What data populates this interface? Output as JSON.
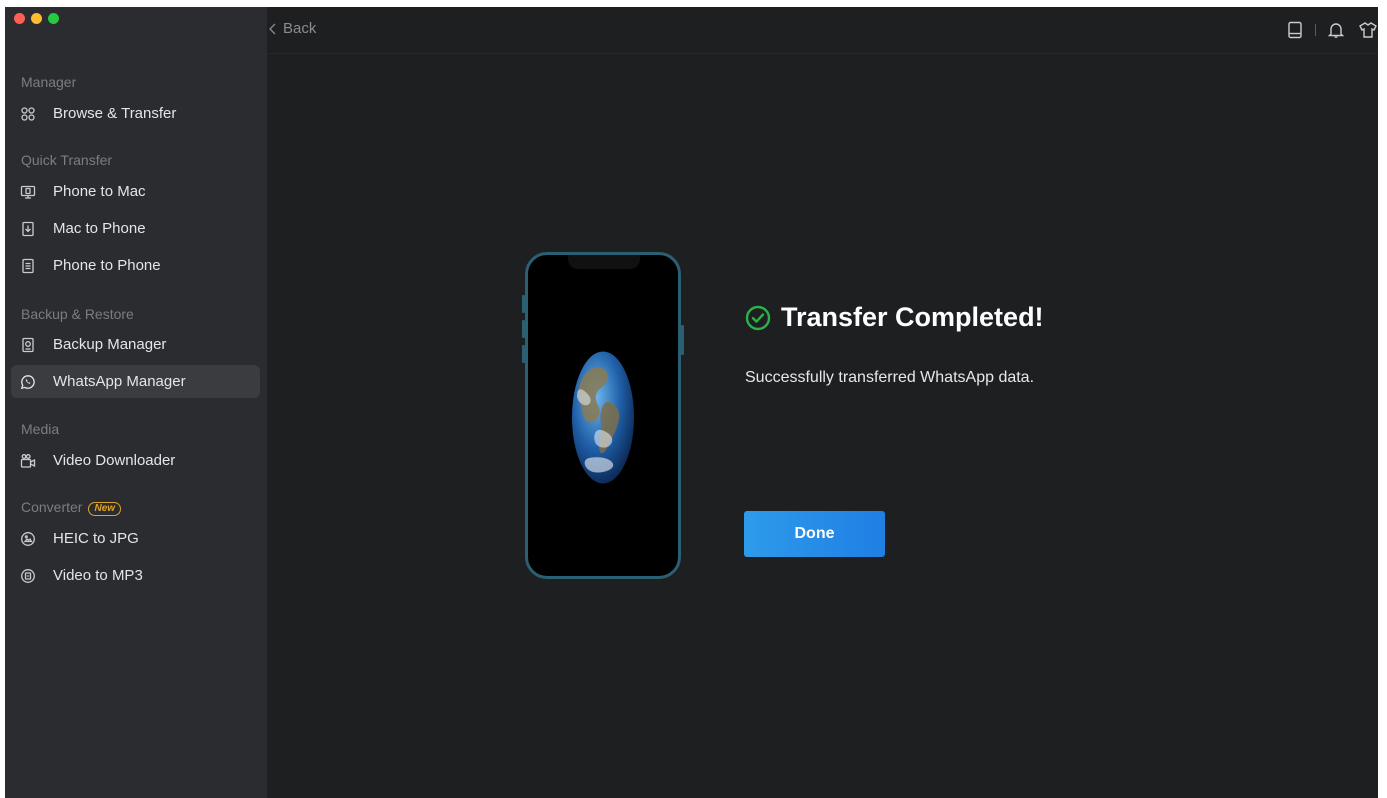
{
  "topbar": {
    "back_label": "Back"
  },
  "sidebar": {
    "sections": {
      "manager": "Manager",
      "quick_transfer": "Quick Transfer",
      "backup_restore": "Backup & Restore",
      "media": "Media",
      "converter": "Converter",
      "converter_badge": "New"
    },
    "items": [
      {
        "label": "Browse & Transfer",
        "icon": "browse-icon"
      },
      {
        "label": "Phone to Mac",
        "icon": "phone-to-mac-icon"
      },
      {
        "label": "Mac to Phone",
        "icon": "mac-to-phone-icon"
      },
      {
        "label": "Phone to Phone",
        "icon": "phone-to-phone-icon"
      },
      {
        "label": "Backup Manager",
        "icon": "backup-icon"
      },
      {
        "label": "WhatsApp Manager",
        "icon": "whatsapp-icon",
        "active": true
      },
      {
        "label": "Video Downloader",
        "icon": "video-downloader-icon"
      },
      {
        "label": "HEIC to JPG",
        "icon": "heic-icon"
      },
      {
        "label": "Video to MP3",
        "icon": "mp3-icon"
      }
    ]
  },
  "main": {
    "title": "Transfer Completed!",
    "subtitle": "Successfully transferred WhatsApp data.",
    "done_label": "Done"
  },
  "colors": {
    "accent": "#2a8ce8",
    "success": "#2bb24c",
    "background": "#1e1f21",
    "sidebar": "#2b2c2f",
    "badge": "#e0a32a"
  }
}
